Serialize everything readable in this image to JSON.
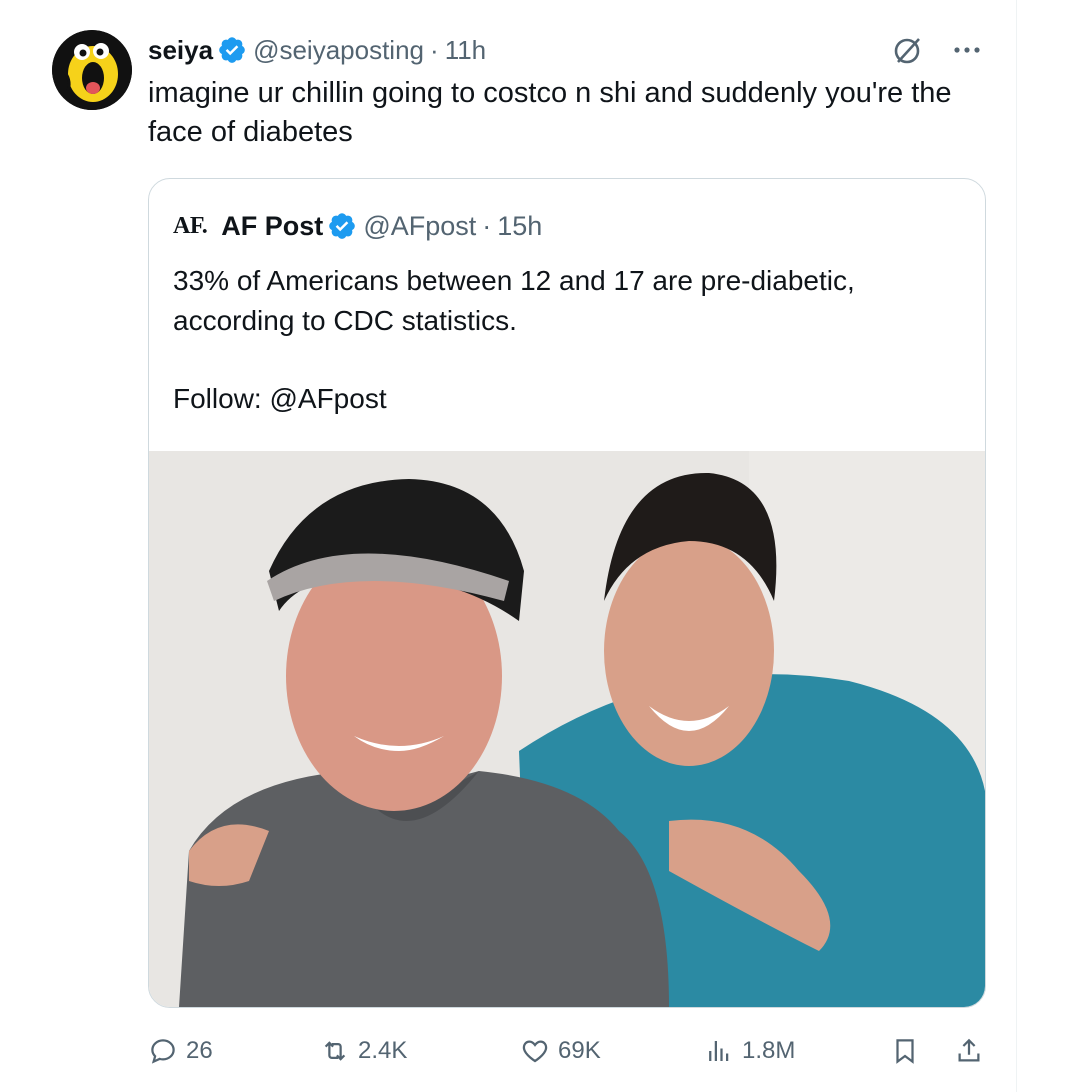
{
  "tweet": {
    "author_name": "seiya",
    "handle": "@seiyaposting",
    "separator": "·",
    "time": "11h",
    "text": "imagine ur chillin going to costco n shi and suddenly you're the face of diabetes",
    "avatar_icon": "cartoon-face-avatar",
    "verified_icon": "verified-badge-icon",
    "accent": "#1d9bf0"
  },
  "quote": {
    "logo_text": "AF.",
    "author_name": "AF Post",
    "handle": "@AFpost",
    "separator": "·",
    "time": "15h",
    "text": "33% of Americans between 12 and 17 are pre-diabetic, according to CDC statistics.",
    "follow_text": "Follow: @AFpost",
    "image_description": "photo of smiling man in black cap and grey shirt with teen boy in teal shirt"
  },
  "actions": {
    "replies": "26",
    "reposts": "2.4K",
    "likes": "69K",
    "views": "1.8M"
  }
}
